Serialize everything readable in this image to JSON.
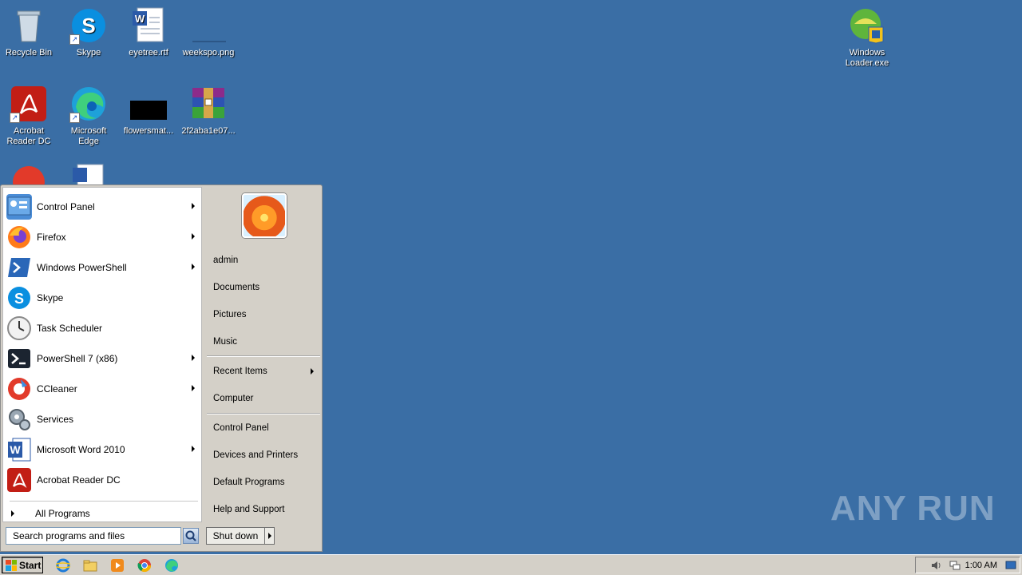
{
  "desktop": {
    "icons": [
      {
        "label": "Recycle Bin"
      },
      {
        "label": "Skype"
      },
      {
        "label": "eyetree.rtf"
      },
      {
        "label": "weekspo.png"
      },
      {
        "label": "Windows Loader.exe"
      },
      {
        "label": "Acrobat Reader DC"
      },
      {
        "label": "Microsoft Edge"
      },
      {
        "label": "flowersmat..."
      },
      {
        "label": "2f2aba1e07..."
      }
    ]
  },
  "start_menu": {
    "programs": [
      {
        "label": "Control Panel",
        "icon": "control-panel-icon",
        "has_submenu": true
      },
      {
        "label": "Firefox",
        "icon": "firefox-icon",
        "has_submenu": true
      },
      {
        "label": "Windows PowerShell",
        "icon": "powershell-icon",
        "has_submenu": true
      },
      {
        "label": "Skype",
        "icon": "skype-icon",
        "has_submenu": false
      },
      {
        "label": "Task Scheduler",
        "icon": "clock-icon",
        "has_submenu": false
      },
      {
        "label": "PowerShell 7 (x86)",
        "icon": "powershell7-icon",
        "has_submenu": true
      },
      {
        "label": "CCleaner",
        "icon": "ccleaner-icon",
        "has_submenu": true
      },
      {
        "label": "Services",
        "icon": "gears-icon",
        "has_submenu": false
      },
      {
        "label": "Microsoft Word 2010",
        "icon": "word-icon",
        "has_submenu": true
      },
      {
        "label": "Acrobat Reader DC",
        "icon": "acrobat-icon",
        "has_submenu": false
      }
    ],
    "all_programs": "All Programs",
    "search_placeholder": "Search programs and files",
    "right": {
      "user": "admin",
      "documents": "Documents",
      "pictures": "Pictures",
      "music": "Music",
      "recent_items": "Recent Items",
      "computer": "Computer",
      "control_panel": "Control Panel",
      "devices_printers": "Devices and Printers",
      "default_programs": "Default Programs",
      "help_support": "Help and Support"
    },
    "shutdown_label": "Shut down"
  },
  "taskbar": {
    "start_label": "Start",
    "clock": "1:00 AM"
  },
  "watermark": "ANY RUN"
}
